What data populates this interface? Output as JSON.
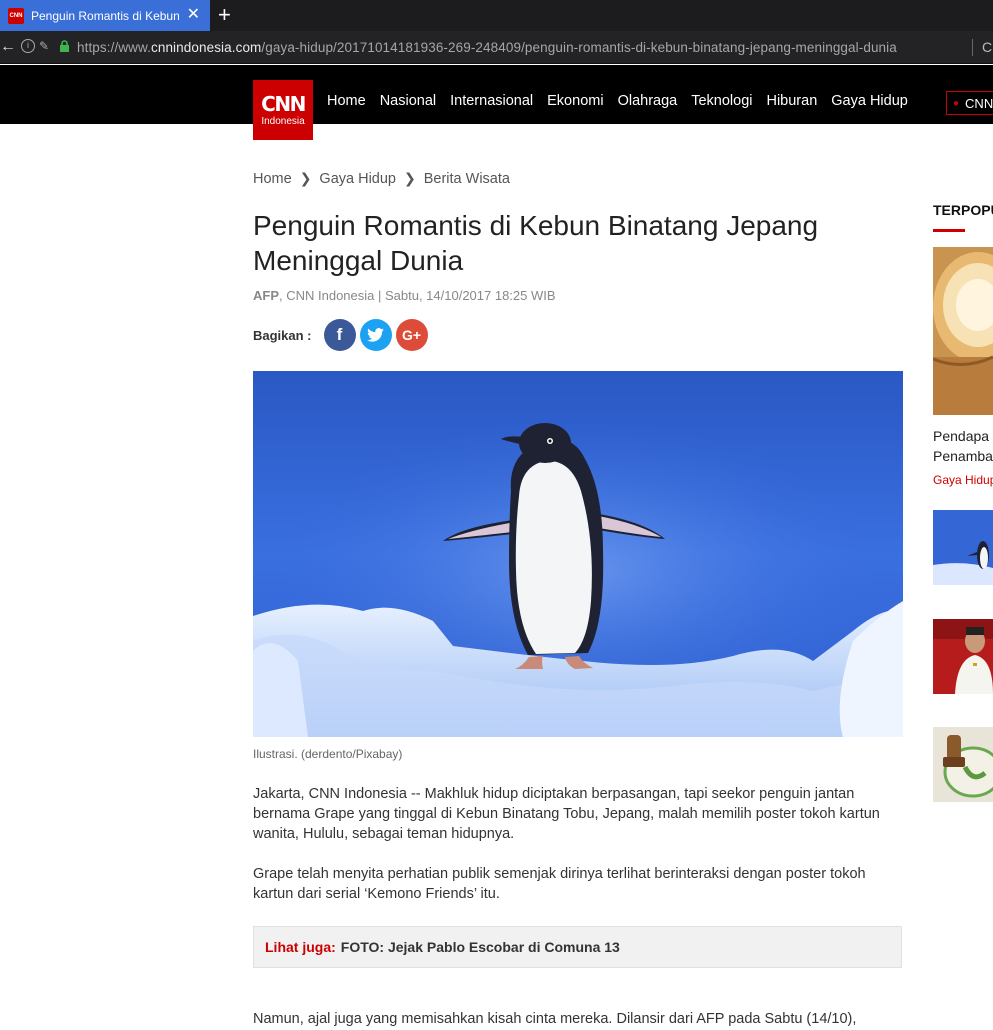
{
  "browser": {
    "tab_title": "Penguin Romantis di Kebun",
    "tab_favicon": "CNN",
    "url_prefix": "https://www.",
    "url_host": "cnnindonesia.com",
    "url_path": "/gaya-hidup/20171014181936-269-248409/penguin-romantis-di-kebun-binatang-jepang-meninggal-dunia",
    "icons": [
      "back-arrow-icon",
      "info-icon",
      "permissions-icon",
      "lock-icon",
      "reload-icon"
    ]
  },
  "site": {
    "logo_main": "CNN",
    "logo_sub": "Indonesia",
    "nav": [
      "Home",
      "Nasional",
      "Internasional",
      "Ekonomi",
      "Olahraga",
      "Teknologi",
      "Hiburan",
      "Gaya Hidup"
    ],
    "live_label": "CNN",
    "brand_color": "#cc0000"
  },
  "article": {
    "breadcrumb": [
      "Home",
      "Gaya Hidup",
      "Berita Wisata"
    ],
    "title": "Penguin Romantis di Kebun Binatang Jepang Meninggal Dunia",
    "source": "AFP",
    "meta": ", CNN Indonesia | Sabtu, 14/10/2017 18:25 WIB",
    "share_label": "Bagikan :",
    "share_buttons": [
      "facebook-icon",
      "twitter-icon",
      "google-plus-icon"
    ],
    "caption": "Ilustrasi. (derdento/Pixabay)",
    "paragraphs": [
      "Jakarta, CNN Indonesia -- Makhluk hidup diciptakan berpasangan, tapi seekor penguin jantan bernama Grape yang tinggal di Kebun Binatang Tobu, Jepang, malah memilih poster tokoh kartun wanita, Hululu, sebagai teman hidupnya.",
      "Grape telah menyita perhatian publik semenjak dirinya terlihat berinteraksi dengan poster tokoh kartun dari serial ‘Kemono Friends’ itu.",
      "Namun, ajal juga yang memisahkan kisah cinta mereka. Dilansir dari AFP pada Sabtu (14/10),"
    ],
    "related_label": "Lihat juga:",
    "related_link": "FOTO: Jejak Pablo Escobar di Comuna 13"
  },
  "sidebar": {
    "title": "TERPOPULER",
    "headline": "Pendapatan Penambahan",
    "headline_line1": "Pendapa",
    "headline_line2": "Penamba",
    "category": "Gaya Hidup"
  }
}
